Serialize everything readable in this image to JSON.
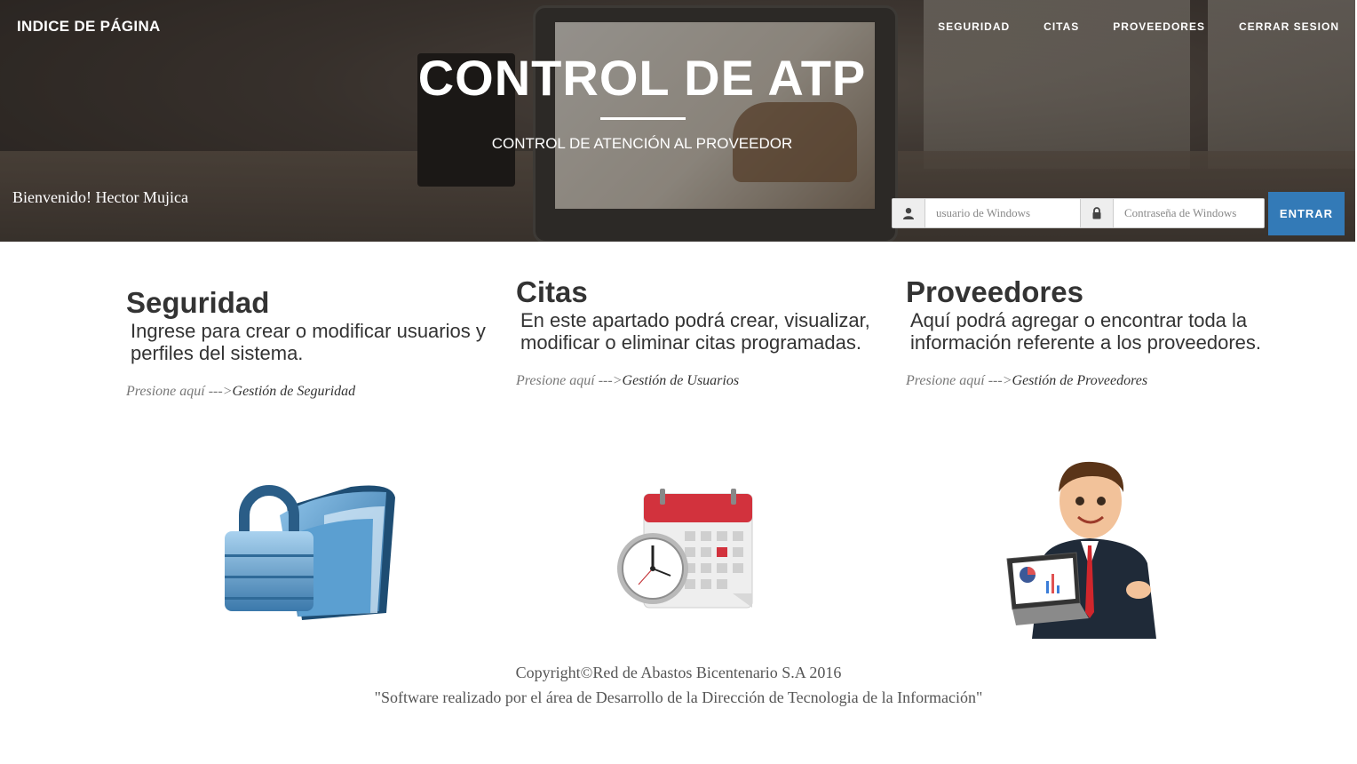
{
  "brand": "INDICE DE PÁGINA",
  "nav": [
    "SEGURIDAD",
    "CITAS",
    "PROVEEDORES",
    "CERRAR SESION"
  ],
  "hero": {
    "title": "CONTROL DE ATP",
    "subtitle": "CONTROL DE ATENCIÓN AL PROVEEDOR",
    "welcome": "Bienvenido! Hector Mujica"
  },
  "login": {
    "user_placeholder": "usuario de Windows",
    "pass_placeholder": "Contraseña de Windows",
    "submit_label": "ENTRAR",
    "user_icon": "user-icon",
    "pass_icon": "lock-icon"
  },
  "sections": [
    {
      "title": "Seguridad",
      "description": "Ingrese para crear o modificar usuarios y perfiles del sistema.",
      "prompt": "Presione aquí --->",
      "link": "Gestión de Seguridad",
      "image": "security-folder-image"
    },
    {
      "title": "Citas",
      "description": "En este apartado podrá crear, visualizar, modificar o eliminar citas programadas.",
      "prompt": "Presione aquí --->",
      "link": "Gestión de Usuarios",
      "image": "calendar-clock-image"
    },
    {
      "title": "Proveedores",
      "description": "Aquí podrá agregar o encontrar toda la información referente a los proveedores.",
      "prompt": "Presione aquí --->",
      "link": "Gestión de Proveedores",
      "image": "businessman-laptop-image"
    }
  ],
  "footer": {
    "copyright": "Copyright©Red de Abastos Bicentenario S.A 2016",
    "credit": "\"Software realizado por el área de Desarrollo de la Dirección de Tecnologia de la Información\""
  },
  "colors": {
    "primary_button": "#337ab7",
    "text_dark": "#333333",
    "text_muted": "#777777"
  }
}
